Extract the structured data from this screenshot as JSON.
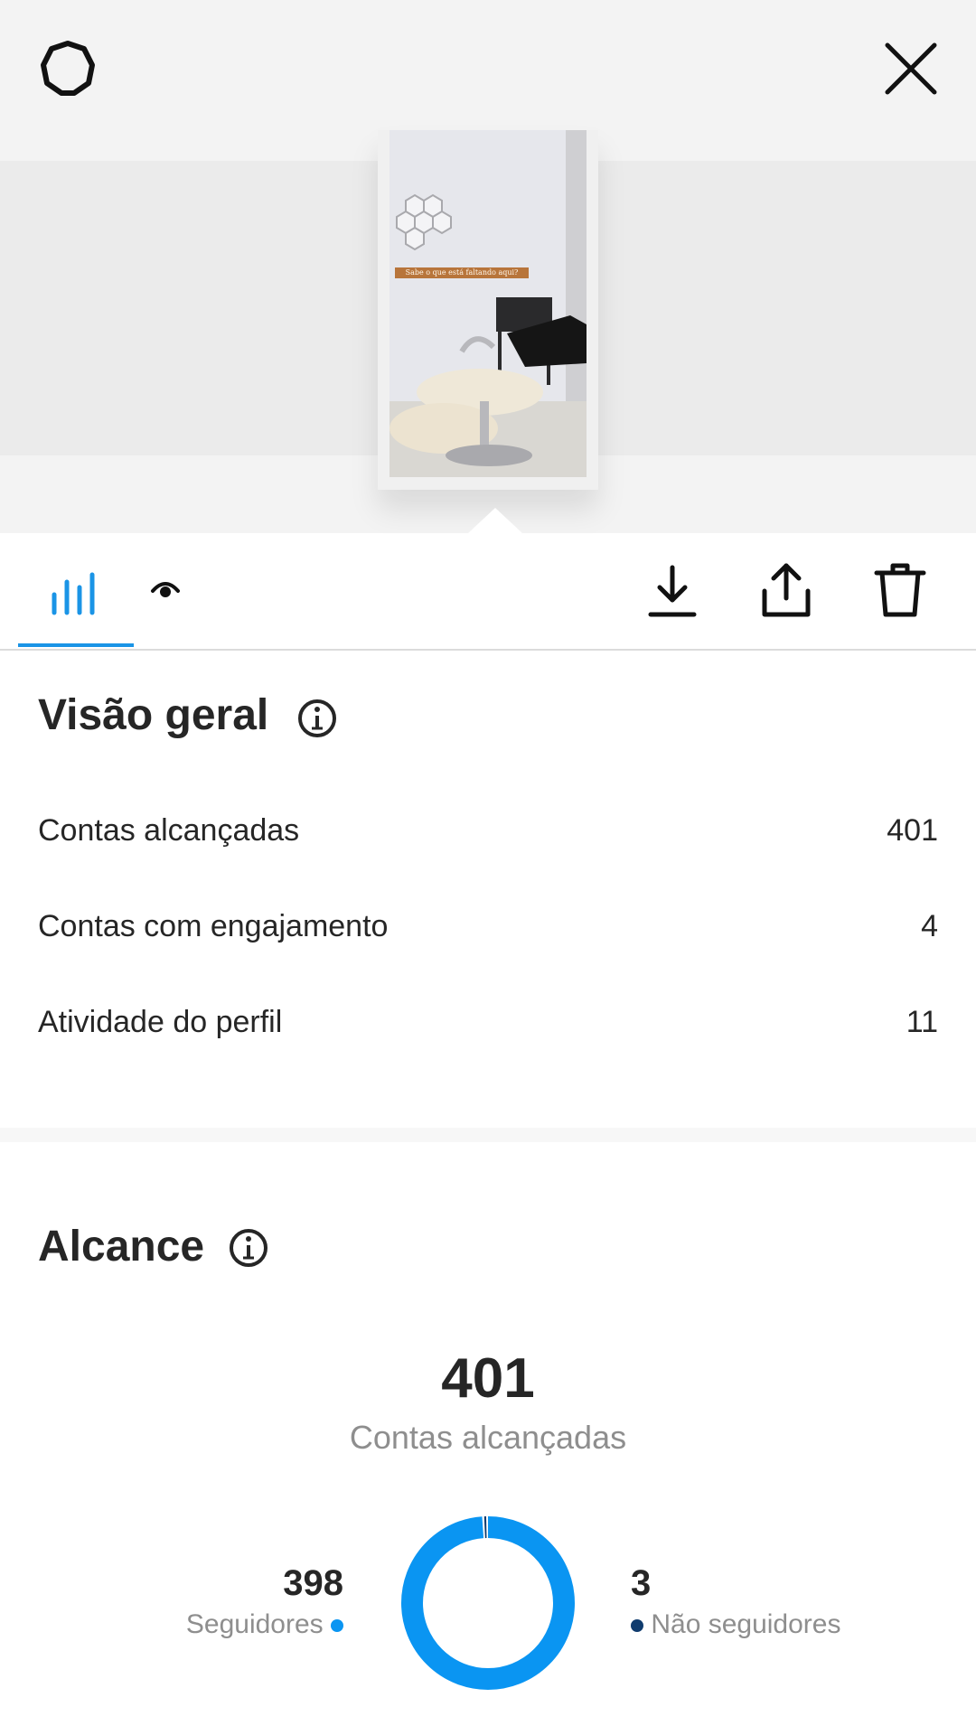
{
  "header": {
    "settings_icon": "gear-icon",
    "close_icon": "close-icon",
    "story_caption": "Sabe o que está faltando aqui?"
  },
  "toolbar": {
    "tabs": [
      {
        "icon": "bar-chart-icon",
        "active": true
      },
      {
        "icon": "eye-icon",
        "active": false
      }
    ],
    "actions": [
      {
        "icon": "download-icon"
      },
      {
        "icon": "share-icon"
      },
      {
        "icon": "trash-icon"
      }
    ],
    "accent_color": "#1a94e6"
  },
  "overview": {
    "title": "Visão geral",
    "rows": [
      {
        "label": "Contas alcançadas",
        "value": "401"
      },
      {
        "label": "Contas com engajamento",
        "value": "4"
      },
      {
        "label": "Atividade do perfil",
        "value": "11"
      }
    ]
  },
  "reach": {
    "title": "Alcance",
    "total": "401",
    "total_label": "Contas alcançadas",
    "followers": {
      "value": "398",
      "label": "Seguidores",
      "color": "#0a95f2"
    },
    "non_followers": {
      "value": "3",
      "label": "Não seguidores",
      "color": "#103c6e"
    }
  },
  "chart_data": {
    "type": "pie",
    "categories": [
      "Seguidores",
      "Não seguidores"
    ],
    "values": [
      398,
      3
    ],
    "colors": [
      "#0a95f2",
      "#103c6e"
    ]
  }
}
